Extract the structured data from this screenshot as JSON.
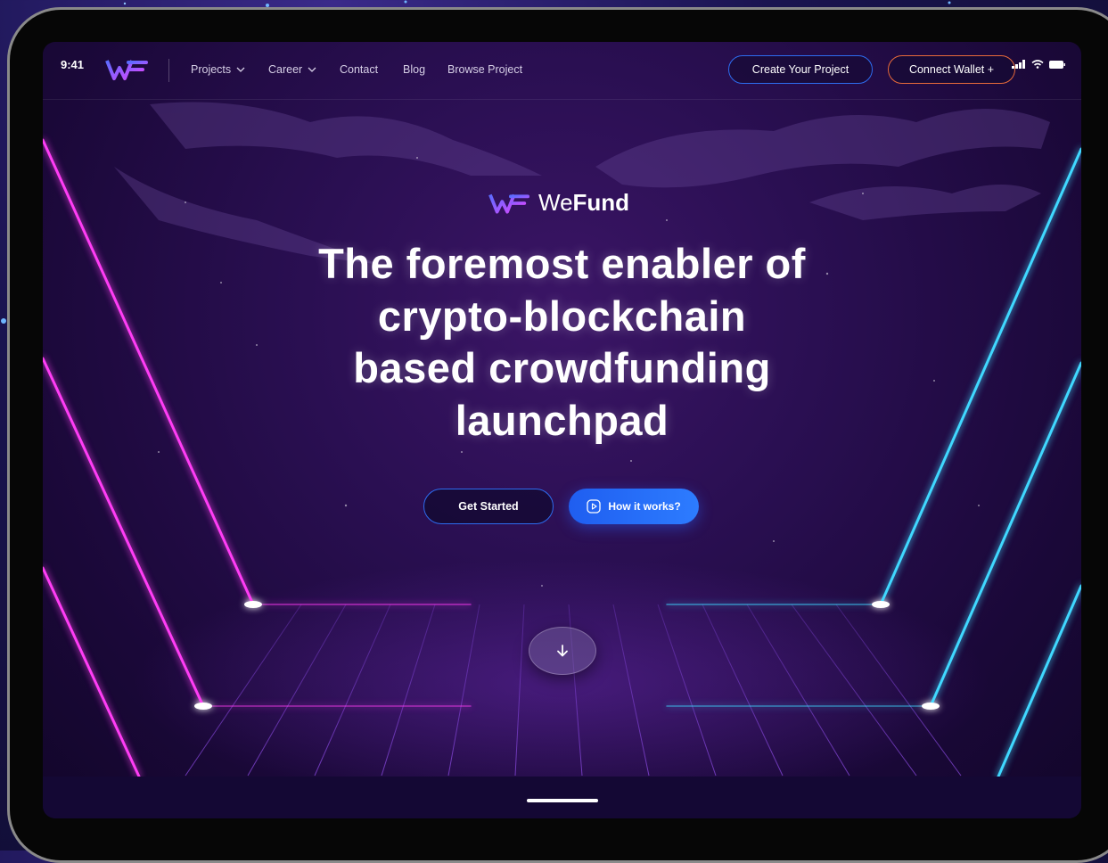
{
  "status_bar": {
    "time": "9:41"
  },
  "nav": {
    "items": [
      {
        "label": "Projects",
        "has_dropdown": true
      },
      {
        "label": "Career",
        "has_dropdown": true
      },
      {
        "label": "Contact",
        "has_dropdown": false
      },
      {
        "label": "Blog",
        "has_dropdown": false
      },
      {
        "label": "Browse Project",
        "has_dropdown": false
      }
    ],
    "create_project_label": "Create Your Project",
    "connect_wallet_label": "Connect Wallet +"
  },
  "hero": {
    "brand_prefix": "We",
    "brand_suffix": "Fund",
    "headline_lines": [
      "The foremost enabler of",
      "crypto-blockchain",
      "based crowdfunding",
      "launchpad"
    ],
    "get_started_label": "Get Started",
    "how_it_works_label": "How it works?"
  },
  "colors": {
    "accent_blue": "#2d6cf0",
    "accent_orange": "#e86a3a",
    "neon_pink": "#ff3df5",
    "neon_cyan": "#3fd8ff"
  },
  "icons": {
    "logo": "wefund-logo-icon",
    "dropdown": "chevron-down-icon",
    "play": "play-icon",
    "scroll": "arrow-down-icon"
  }
}
